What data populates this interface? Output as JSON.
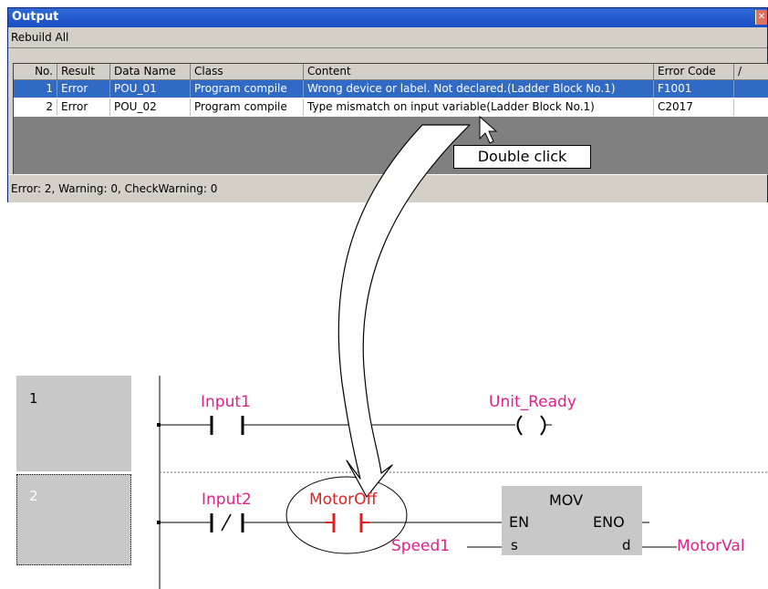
{
  "output": {
    "title": "Output",
    "close_icon": "✕",
    "rebuild_label": "Rebuild All",
    "columns": [
      "No.",
      "Result",
      "Data Name",
      "Class",
      "Content",
      "Error Code",
      "/"
    ],
    "rows": [
      {
        "no": "1",
        "result": "Error",
        "data_name": "POU_01",
        "class": "Program compile",
        "content": "Wrong device or label. Not declared.(Ladder Block No.1)",
        "error_code": "F1001"
      },
      {
        "no": "2",
        "result": "Error",
        "data_name": "POU_02",
        "class": "Program compile",
        "content": "Type mismatch on input variable(Ladder Block No.1)",
        "error_code": "C2017"
      }
    ],
    "status": "Error: 2, Warning: 0, CheckWarning: 0"
  },
  "callout": "Double click",
  "ladder": {
    "row1": {
      "number": "1",
      "contact_label": "Input1",
      "coil_label": "Unit_Ready"
    },
    "row2": {
      "number": "2",
      "contact_label": "Input2",
      "error_contact_label": "MotorOff",
      "block_name": "MOV",
      "en": "EN",
      "eno": "ENO",
      "s": "s",
      "d": "d",
      "s_input": "Speed1",
      "d_output": "MotorVal"
    }
  },
  "colors": {
    "selection": "#316ac5",
    "label": "#e0208a",
    "error": "#e02020",
    "title_bar": "#1b4fc2"
  }
}
